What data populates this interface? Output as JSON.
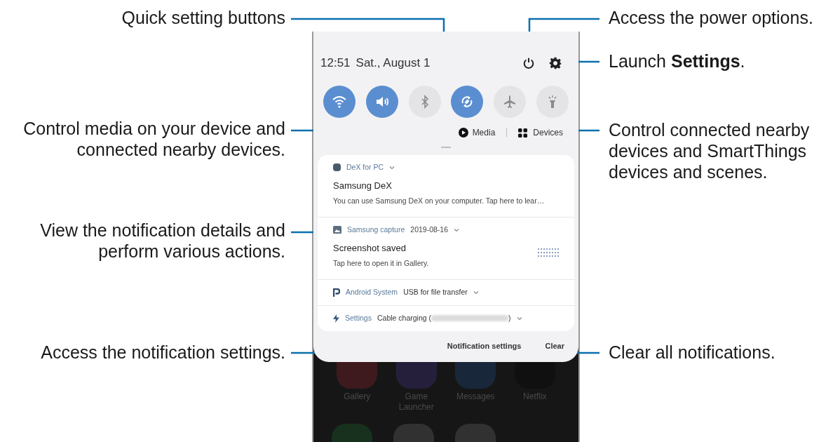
{
  "left_callouts": [
    "Quick setting buttons",
    "Control media on your device and connected nearby devices.",
    "View the notification details and perform various actions.",
    "Access the notification settings."
  ],
  "right_callouts": [
    "Access the power options.",
    "Launch **Settings**.",
    "Control connected nearby devices and SmartThings devices and scenes.",
    "Clear all notifications."
  ],
  "phone": {
    "status": {
      "time": "12:51",
      "date": "Sat., August 1"
    },
    "quick_settings": [
      {
        "kind": "wifi",
        "on": true
      },
      {
        "kind": "sound",
        "on": true
      },
      {
        "kind": "bluetooth",
        "on": false
      },
      {
        "kind": "sync",
        "on": true
      },
      {
        "kind": "airplane",
        "on": false
      },
      {
        "kind": "flashlight",
        "on": false
      }
    ],
    "media_button": "Media",
    "devices_button": "Devices",
    "notifications": [
      {
        "kind": "dex",
        "app": "DeX for PC",
        "title": "Samsung DeX",
        "body": "You can use Samsung DeX on your computer. Tap here to lear…"
      },
      {
        "kind": "image",
        "app": "Samsung capture",
        "time": "2019-08-16",
        "title": "Screenshot saved",
        "body": "Tap here to open it in Gallery."
      },
      {
        "kind": "android",
        "app": "Android System",
        "summary": "USB for file transfer"
      },
      {
        "kind": "charging",
        "app": "Settings",
        "summary_before": "Cable charging (",
        "summary_after": ")"
      }
    ],
    "footer": {
      "settings_button": "Notification settings",
      "clear_button": "Clear"
    },
    "home_apps": [
      {
        "label": "Gallery",
        "color": "#3e1a1e"
      },
      {
        "label": "Game Launcher",
        "color": "#261f3c"
      },
      {
        "label": "Messages",
        "color": "#18283a"
      },
      {
        "label": "Netflix",
        "color": "#101010"
      }
    ]
  }
}
